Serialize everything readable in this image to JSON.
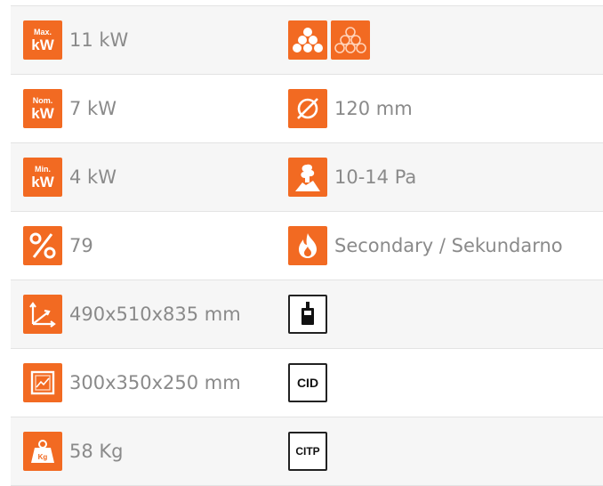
{
  "rows": [
    {
      "left": {
        "icon": "max-kw-icon",
        "icon_top": "Max.",
        "icon_bottom": "kW",
        "value": "11 kW"
      },
      "right": {
        "icon": "pellet-logs-icons",
        "value": ""
      }
    },
    {
      "left": {
        "icon": "nom-kw-icon",
        "icon_top": "Nom.",
        "icon_bottom": "kW",
        "value": "7 kW"
      },
      "right": {
        "icon": "diameter-icon",
        "value": "120 mm"
      }
    },
    {
      "left": {
        "icon": "min-kw-icon",
        "icon_top": "Min.",
        "icon_bottom": "kW",
        "value": "4 kW"
      },
      "right": {
        "icon": "chimney-draft-icon",
        "value": "10-14 Pa"
      }
    },
    {
      "left": {
        "icon": "efficiency-percent-icon",
        "value": "79"
      },
      "right": {
        "icon": "secondary-fire-icon",
        "value": "Secondary / Sekundarno"
      }
    },
    {
      "left": {
        "icon": "dimensions-icon",
        "value": "490x510x835 mm"
      },
      "right": {
        "icon": "remote-control-icon",
        "value": ""
      }
    },
    {
      "left": {
        "icon": "firebox-icon",
        "value": "300x350x250 mm"
      },
      "right": {
        "icon": "cid-icon",
        "icon_text": "CID",
        "value": ""
      }
    },
    {
      "left": {
        "icon": "weight-kg-icon",
        "icon_text": "Kg",
        "value": "58 Kg"
      },
      "right": {
        "icon": "citp-icon",
        "icon_text": "CITP",
        "value": ""
      }
    }
  ],
  "colors": {
    "accent": "#f26a22",
    "text": "#8a8a8a",
    "divider": "#e3e3e3"
  }
}
